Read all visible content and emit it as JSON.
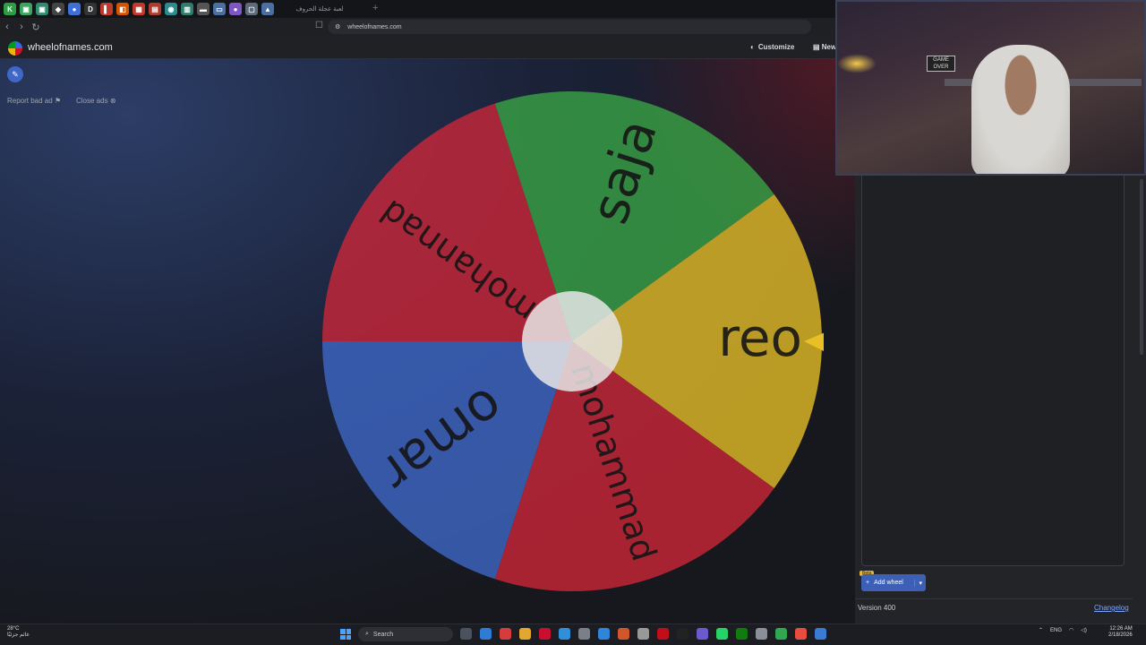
{
  "browser": {
    "tab_title": "لعبة عجلة الحروف",
    "url": "wheelofnames.com",
    "favicons": [
      {
        "color": "#2e9e45",
        "glyph": "K"
      },
      {
        "color": "#3aa55d",
        "glyph": "▣"
      },
      {
        "color": "#2f8c6e",
        "glyph": "▣"
      },
      {
        "color": "#444",
        "glyph": "◆"
      },
      {
        "color": "#3f6fd8",
        "glyph": "●"
      },
      {
        "color": "#333",
        "glyph": "D"
      },
      {
        "color": "#c0392b",
        "glyph": "▌"
      },
      {
        "color": "#d35400",
        "glyph": "◧"
      },
      {
        "color": "#c0392b",
        "glyph": "▦"
      },
      {
        "color": "#b03a2e",
        "glyph": "▤"
      },
      {
        "color": "#2a8c8c",
        "glyph": "◉"
      },
      {
        "color": "#2d7d6e",
        "glyph": "▥"
      },
      {
        "color": "#555",
        "glyph": "▬"
      },
      {
        "color": "#4a6fa5",
        "glyph": "▭"
      },
      {
        "color": "#7e57c2",
        "glyph": "●"
      },
      {
        "color": "#5c6b7a",
        "glyph": "▢"
      },
      {
        "color": "#4a6fa5",
        "glyph": "▲"
      }
    ]
  },
  "header": {
    "site_name": "wheelofnames.com",
    "customize_label": "Customize",
    "new_label": "New"
  },
  "ads": {
    "report_label": "Report bad ad",
    "close_label": "Close ads"
  },
  "wheel": {
    "segments": [
      {
        "name": "saja",
        "color": "#3aa745"
      },
      {
        "name": "reo",
        "color": "#e8c026"
      },
      {
        "name": "mohammad",
        "color": "#d02638"
      },
      {
        "name": "omar",
        "color": "#3f69c9"
      },
      {
        "name": "mohannad",
        "color": "#d02638"
      }
    ],
    "hub_color": "#e6e6e6",
    "pointer_color": "#e8c026"
  },
  "panel": {
    "beta_badge": "Beta",
    "add_wheel_label": "Add wheel",
    "version": "Version 400",
    "changelog": "Changelog"
  },
  "webcam": {
    "sign_text": "GAME OVER"
  },
  "taskbar": {
    "weather_temp": "28°C",
    "weather_desc": "غائم جزئيًا",
    "search_placeholder": "Search",
    "lang": "ENG",
    "time": "12:26 AM",
    "date": "2/18/2026",
    "icons": [
      "#4a5260",
      "#2d7cd6",
      "#d83b3b",
      "#e3a72f",
      "#c8102e",
      "#2f8fda",
      "#7a7f88",
      "#2f86d8",
      "#d1562b",
      "#999",
      "#c20e1a",
      "#222",
      "#6a5acd",
      "#25d366",
      "#107c10",
      "#8a8f98",
      "#2fa84f",
      "#e74c3c",
      "#3a7bd5"
    ]
  }
}
